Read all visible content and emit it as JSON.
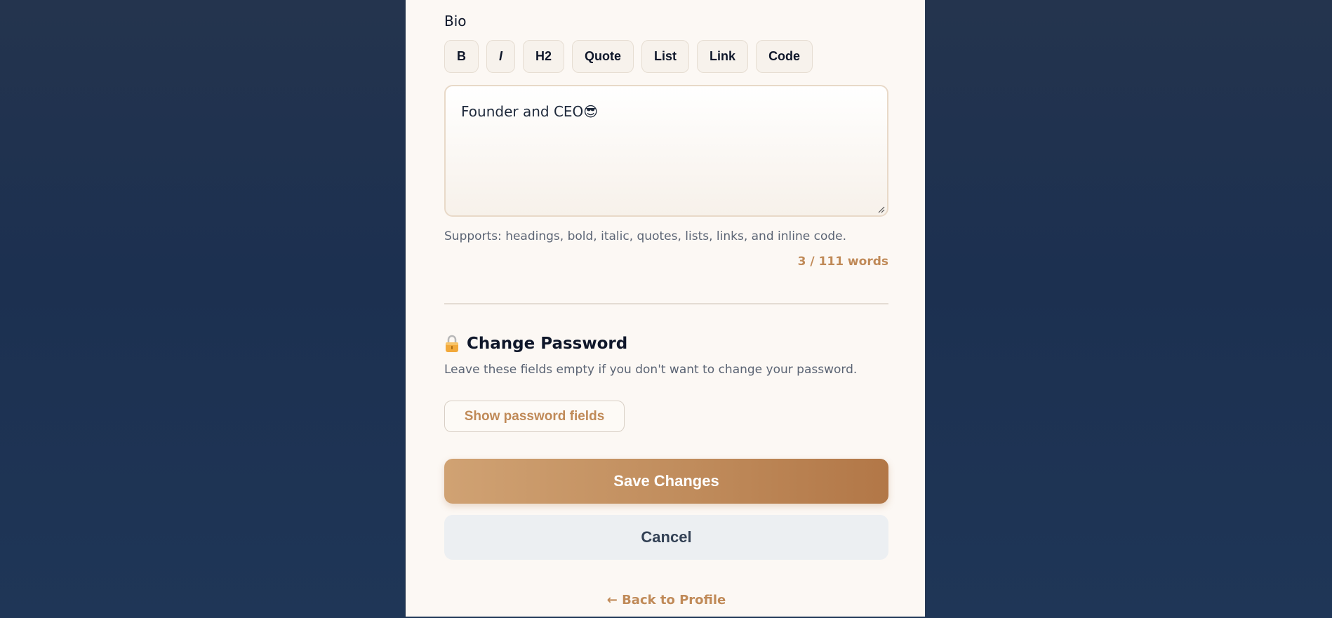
{
  "bio": {
    "label": "Bio",
    "toolbar": [
      "B",
      "I",
      "H2",
      "Quote",
      "List",
      "Link",
      "Code"
    ],
    "text": "Founder and CEO",
    "emoji": "😎",
    "hint": "Supports: headings, bold, italic, quotes, lists, links, and inline code.",
    "word_count": "3 / 111 words"
  },
  "password": {
    "title": "Change Password",
    "icon": "lock-icon",
    "subtitle": "Leave these fields empty if you don't want to change your password.",
    "show_button": "Show password fields"
  },
  "actions": {
    "save": "Save Changes",
    "cancel": "Cancel",
    "back": "← Back to Profile"
  },
  "colors": {
    "accent": "#c08a58",
    "panel": "#fcf8f4",
    "background": "#1f3657"
  }
}
